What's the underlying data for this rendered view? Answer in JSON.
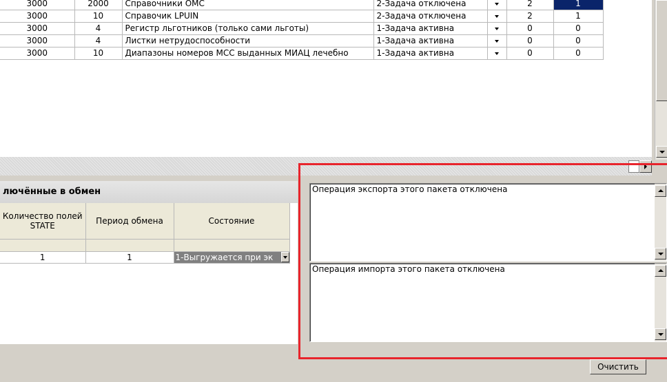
{
  "top_grid": {
    "rows": [
      {
        "a": "3000",
        "b": "2000",
        "name": "Справочники ОМС",
        "status": "2-Задача отключена",
        "n1": "2",
        "n2": "1",
        "selected": true
      },
      {
        "a": "3000",
        "b": "10",
        "name": "Справочик LPUIN",
        "status": "2-Задача отключена",
        "n1": "2",
        "n2": "1"
      },
      {
        "a": "3000",
        "b": "4",
        "name": "Регистр льготников (только сами льготы)",
        "status": "1-Задача активна",
        "n1": "0",
        "n2": "0"
      },
      {
        "a": "3000",
        "b": "4",
        "name": "Листки нетрудоспособности",
        "status": "1-Задача активна",
        "n1": "0",
        "n2": "0"
      },
      {
        "a": "3000",
        "b": "10",
        "name": "Диапазоны номеров МСС выданных МИАЦ лечебно",
        "status": "1-Задача активна",
        "n1": "0",
        "n2": "0"
      }
    ]
  },
  "section": {
    "title": "лючённые в обмен"
  },
  "bottom_grid": {
    "headers": [
      "Количество полей STATE",
      "Период обмена",
      "Состояние"
    ],
    "row": {
      "count": "1",
      "period": "1",
      "state": "1-Выгружается при эк"
    }
  },
  "export_memo": {
    "text": "Операция экспорта этого пакета отключена"
  },
  "import_memo": {
    "text": "Операция импорта этого пакета отключена"
  },
  "buttons": {
    "clear": "Очистить"
  },
  "colors": {
    "highlight_frame": "#e8242c",
    "selection": "#0a246a"
  }
}
